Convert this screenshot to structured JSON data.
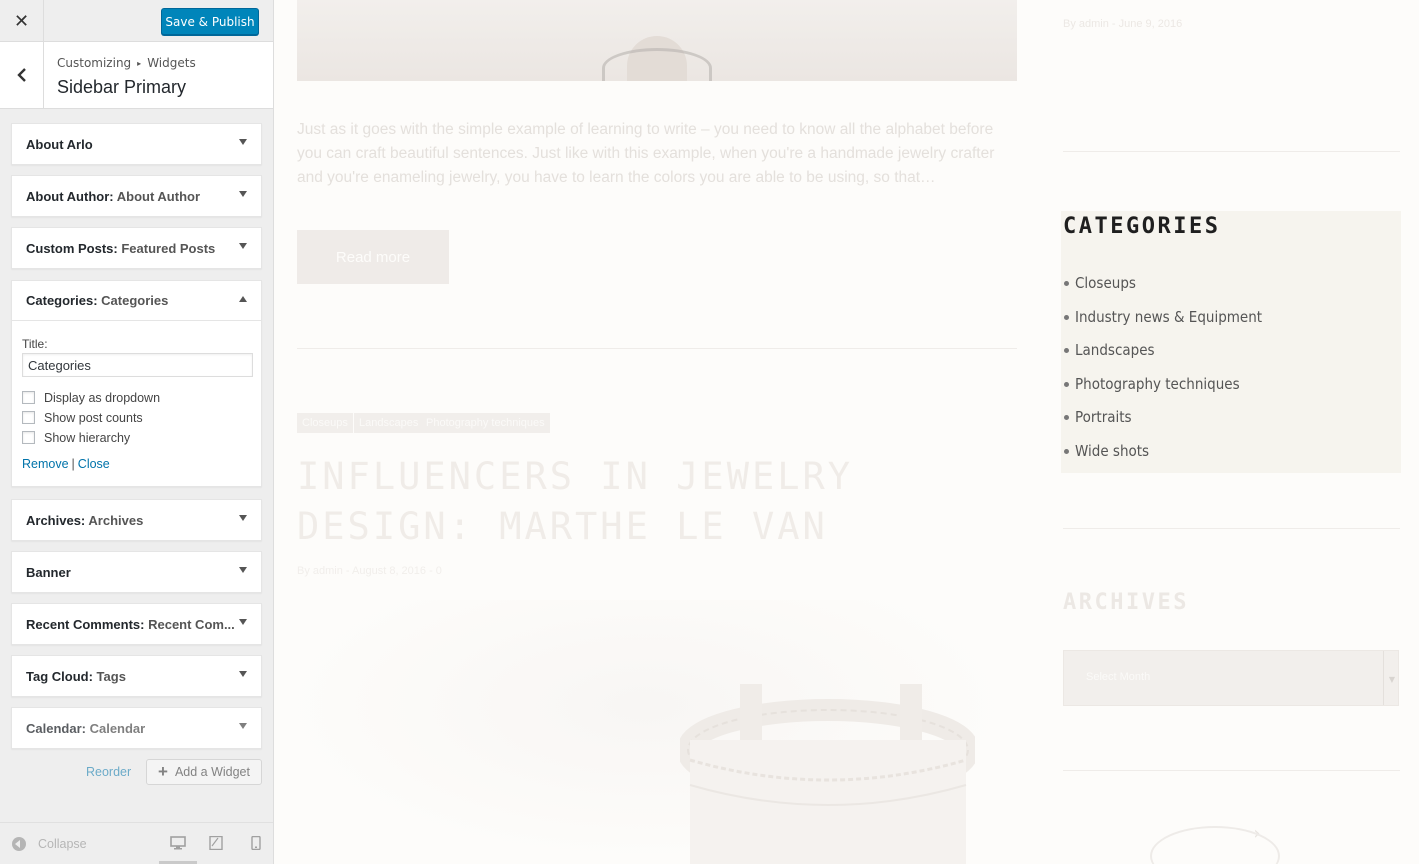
{
  "header": {
    "close_label": "✕",
    "publish_label": "Save & Publish"
  },
  "section": {
    "breadcrumb_root": "Customizing",
    "breadcrumb_sep": "▸",
    "breadcrumb_leaf": "Widgets",
    "title": "Sidebar Primary"
  },
  "widgets": [
    {
      "title": "About Arlo",
      "instance": ""
    },
    {
      "title": "About Author",
      "instance": "About Author"
    },
    {
      "title": "Custom Posts",
      "instance": "Featured Posts"
    },
    {
      "title": "Categories",
      "instance": "Categories"
    },
    {
      "title": "Archives",
      "instance": "Archives"
    },
    {
      "title": "Banner",
      "instance": ""
    },
    {
      "title": "Recent Comments",
      "instance": "Recent Com..."
    },
    {
      "title": "Tag Cloud",
      "instance": "Tags"
    },
    {
      "title": "Calendar",
      "instance": "Calendar"
    }
  ],
  "categories_form": {
    "title_label": "Title:",
    "title_value": "Categories",
    "opt_dropdown": "Display as dropdown",
    "opt_counts": "Show post counts",
    "opt_hierarchy": "Show hierarchy",
    "remove_label": "Remove",
    "pipe": "|",
    "close_label": "Close"
  },
  "panel_actions": {
    "reorder_label": "Reorder",
    "add_widget_label": "Add a Widget"
  },
  "footer": {
    "collapse_label": "Collapse"
  },
  "preview": {
    "excerpt": "Just as it goes with the simple example of learning to write – you need to know all the alphabet before you can craft beautiful sentences. Just like with this example, when you're a handmade jewelry crafter and you're enameling jewelry, you have to learn the colors you are able to be using, so that…",
    "read_more": "Read more",
    "tags": [
      "Closeups",
      "Landscapes",
      "Photography techniques"
    ],
    "post_title": "INFLUENCERS IN JEWELRY DESIGN: MARTHE LE VAN",
    "post_meta": "By admin - August 8, 2016 - 0",
    "top_meta": "By admin - June 9, 2016",
    "next_arrow": "›"
  },
  "sidebar_preview": {
    "categories_heading": "CATEGORIES",
    "categories": [
      "Closeups",
      "Industry news & Equipment",
      "Landscapes",
      "Photography techniques",
      "Portraits",
      "Wide shots"
    ],
    "archives_heading": "ARCHIVES",
    "archives_placeholder": "Select Month"
  }
}
